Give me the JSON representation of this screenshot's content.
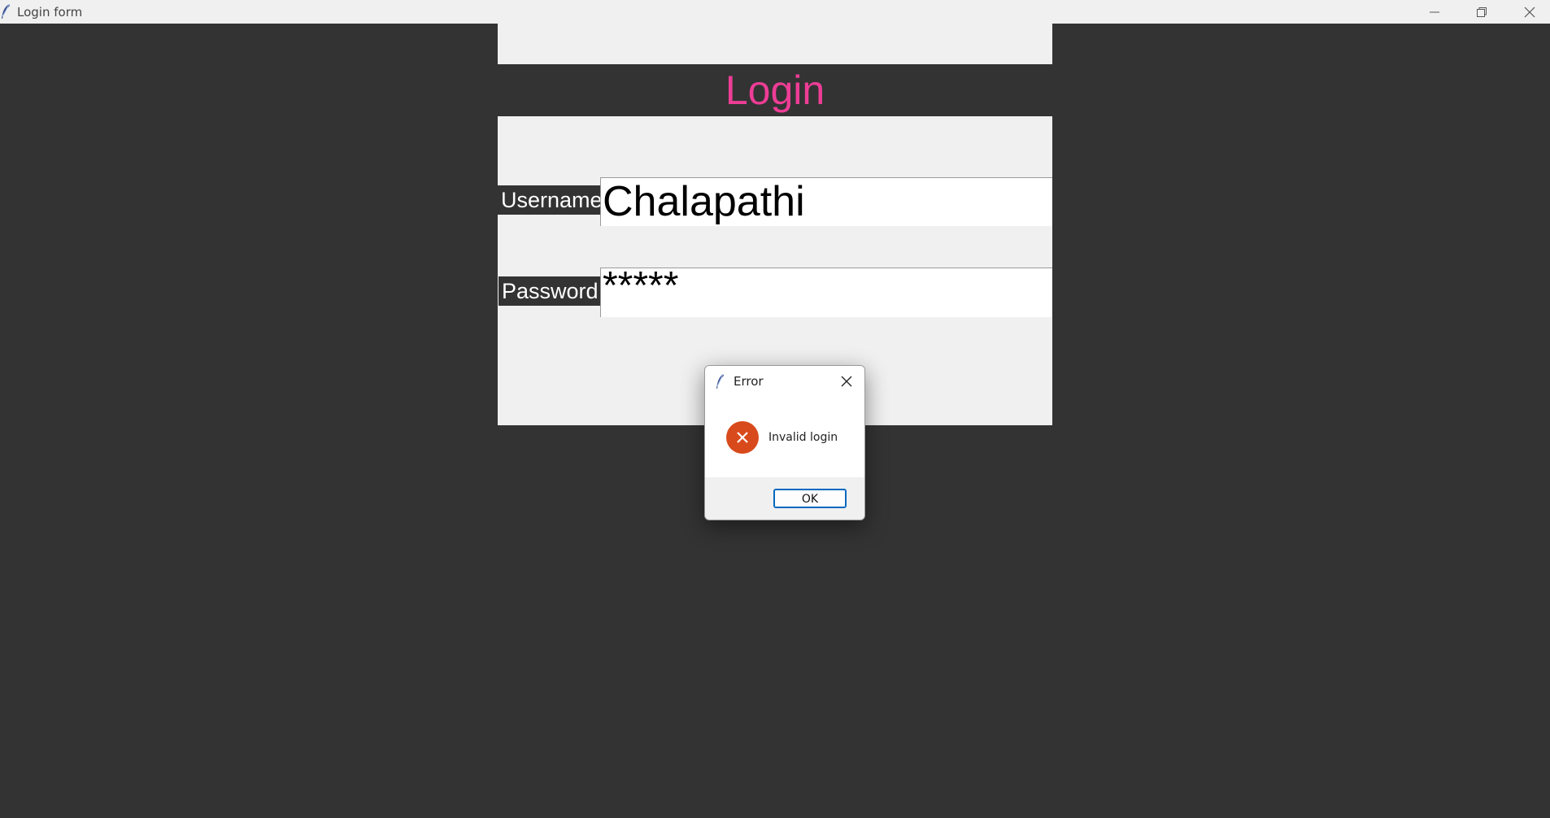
{
  "window": {
    "title": "Login form"
  },
  "form": {
    "heading": "Login",
    "heading_color": "#ee3d96",
    "username_label": "Username",
    "username_value": "Chalapathi",
    "password_label": "Password",
    "password_value": "*****"
  },
  "dialog": {
    "title": "Error",
    "message": "Invalid login",
    "ok_label": "OK",
    "icon": "error-icon",
    "icon_color": "#d84a1b"
  },
  "colors": {
    "background": "#333333",
    "panel": "#f0f0f0",
    "label_bg": "#333333",
    "label_text": "#ffffff"
  }
}
